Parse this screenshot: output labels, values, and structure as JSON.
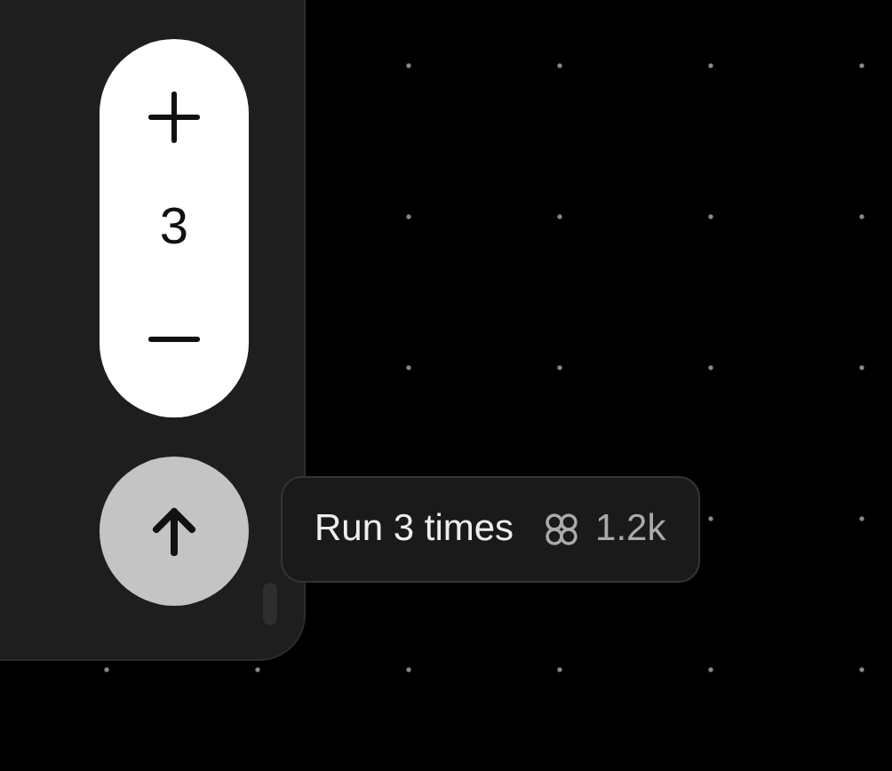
{
  "stepper": {
    "value": "3"
  },
  "run_tooltip": {
    "label": "Run 3 times",
    "cost": "1.2k"
  }
}
